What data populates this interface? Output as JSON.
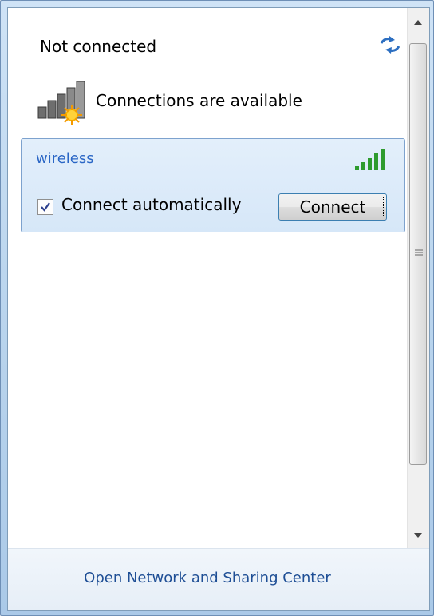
{
  "panel": {
    "status": "Not connected",
    "availability_text": "Connections are available"
  },
  "network": {
    "name": "wireless",
    "auto_connect_label": "Connect automatically",
    "auto_connect_checked": true,
    "connect_button_label": "Connect"
  },
  "footer": {
    "link_text": "Open Network and Sharing Center"
  },
  "icons": {
    "refresh": "refresh-icon",
    "availability": "network-available-icon",
    "signal": "signal-strength-icon"
  },
  "colors": {
    "network_name": "#2a66c5",
    "footer_link": "#1e4e95",
    "card_border": "#7da2ce",
    "signal_green": "#2e9b2e"
  }
}
